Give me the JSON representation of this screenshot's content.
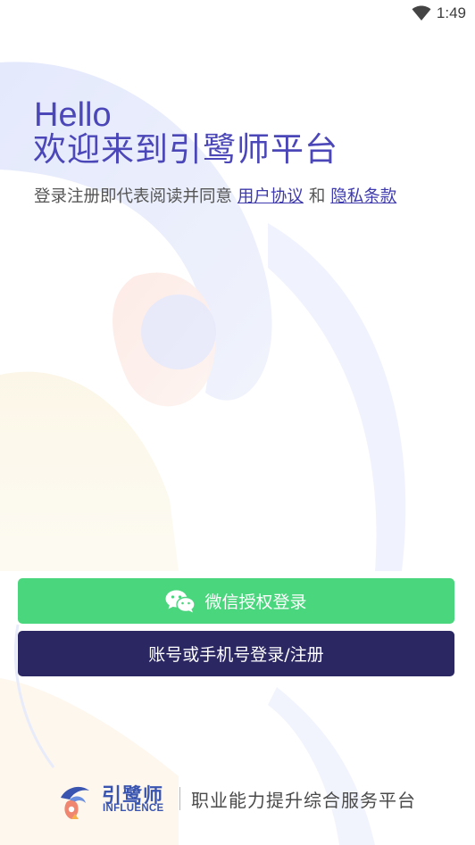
{
  "status_bar": {
    "time": "1:49"
  },
  "header": {
    "hello": "Hello",
    "welcome": "欢迎来到引鹭师平台",
    "agreement_prefix": "登录注册即代表阅读并同意",
    "user_agreement_link": "用户协议",
    "agreement_and": "和",
    "privacy_link": "隐私条款"
  },
  "actions": {
    "wechat_login_label": "微信授权登录",
    "account_login_label": "账号或手机号登录/注册"
  },
  "footer": {
    "brand_cn": "引鹭师",
    "brand_en": "INFLUENCE",
    "tagline": "职业能力提升综合服务平台"
  },
  "colors": {
    "primary": "#4b47b8",
    "wechat_green": "#4ad67d",
    "account_button": "#2a2763",
    "brand_blue": "#3a55b0"
  },
  "icons": {
    "status_wifi": "wifi-icon",
    "wechat": "wechat-icon",
    "logo": "influence-logo-icon"
  }
}
